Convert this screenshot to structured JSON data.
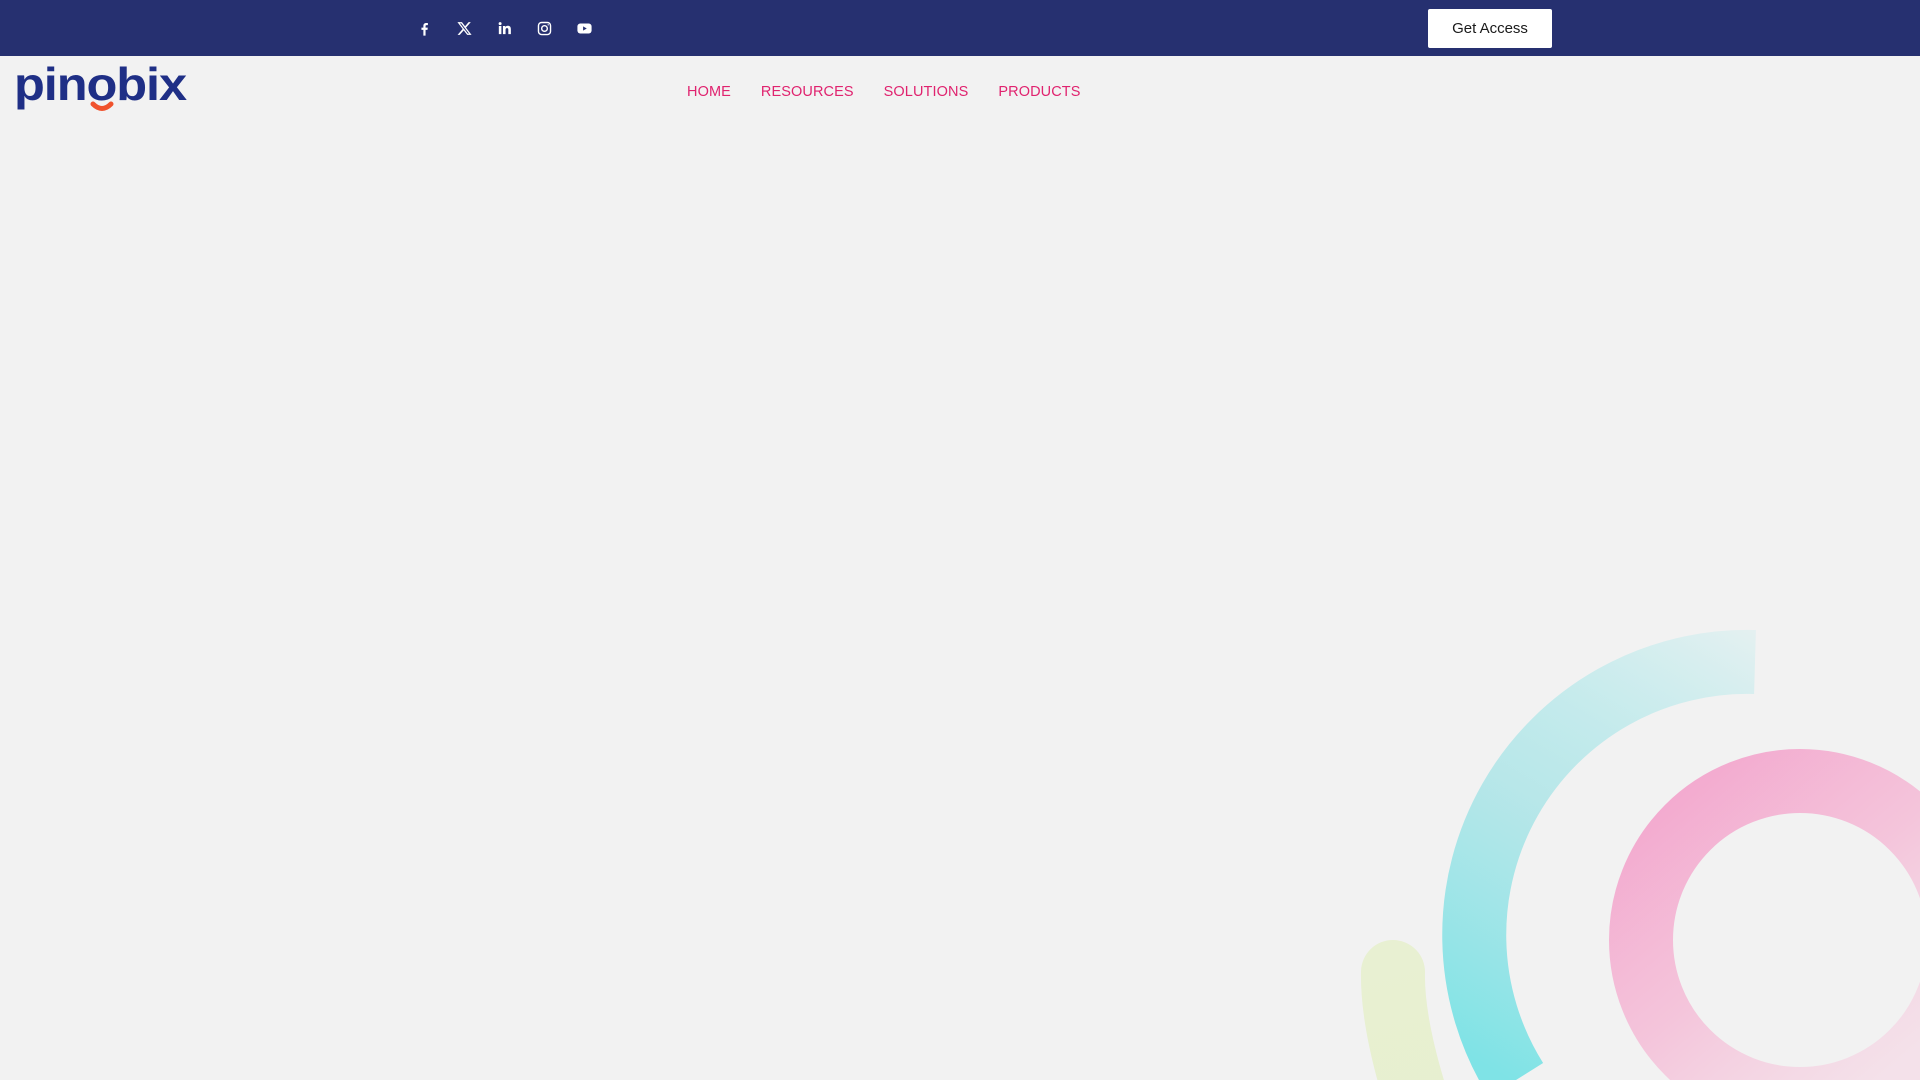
{
  "topbar": {
    "background": "#263070",
    "social": [
      {
        "name": "facebook-icon"
      },
      {
        "name": "x-icon"
      },
      {
        "name": "linkedin-icon"
      },
      {
        "name": "instagram-icon"
      },
      {
        "name": "youtube-icon"
      }
    ],
    "cta_label": "Get Access"
  },
  "header": {
    "logo_text": "pinobix",
    "nav": [
      {
        "label": "HOME"
      },
      {
        "label": "RESOURCES"
      },
      {
        "label": "SOLUTIONS"
      },
      {
        "label": "PRODUCTS"
      }
    ]
  },
  "colors": {
    "page_background": "#f2f2f2",
    "nav_text": "#e0236f",
    "logo_blue": "#1f2f86",
    "logo_orange": "#f0522d",
    "ring_cyan": "#7fe3e6",
    "ring_pink": "#f3a3cc",
    "arc_yellow": "#e8f0d2"
  }
}
